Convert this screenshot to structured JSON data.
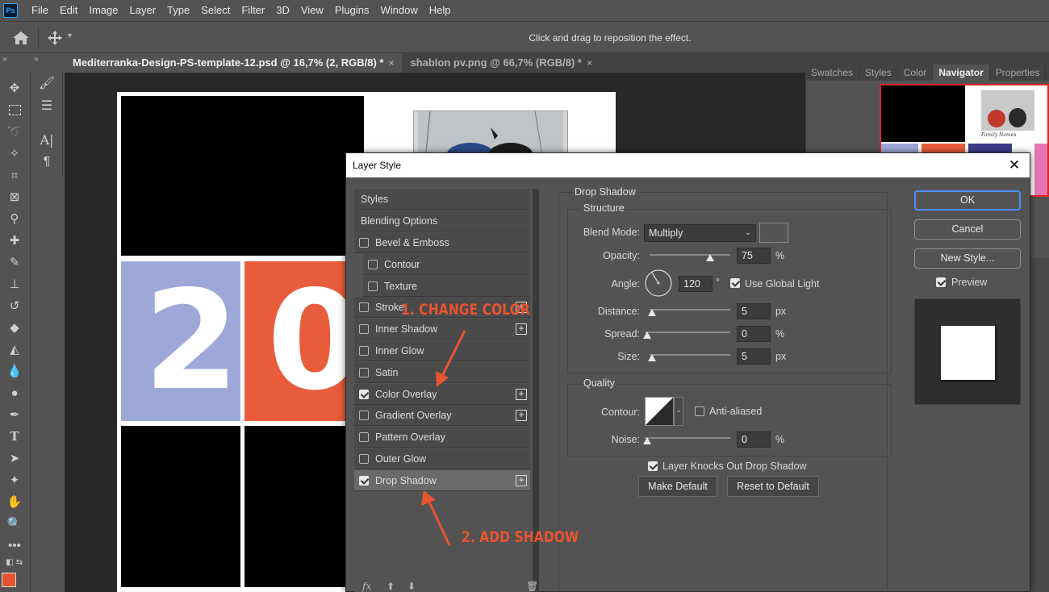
{
  "app": {
    "logo_text": "Ps"
  },
  "menu": [
    "File",
    "Edit",
    "Image",
    "Layer",
    "Type",
    "Select",
    "Filter",
    "3D",
    "View",
    "Plugins",
    "Window",
    "Help"
  ],
  "options_bar": {
    "hint": "Click and drag to reposition the effect."
  },
  "collapse_glyph": "»",
  "tabs": [
    {
      "label": "Mediterranka-Design-PS-template-12.psd @ 16,7% (2, RGB/8) *",
      "close": "×",
      "active": true
    },
    {
      "label": "shablon pv.png @ 66,7% (RGB/8) *",
      "close": "×",
      "active": false
    }
  ],
  "artboard": {
    "digits": [
      "2",
      "0"
    ],
    "colors": {
      "blue": "#9ea8d8",
      "orange": "#e85c3b",
      "black": "#000000"
    }
  },
  "panel_tabs": [
    "Swatches",
    "Styles",
    "Color",
    "Navigator",
    "Properties"
  ],
  "navigator": {
    "caption": "Family Names"
  },
  "dialog": {
    "title": "Layer Style",
    "close": "✕",
    "list_header": "Styles",
    "blending": "Blending Options",
    "items": [
      {
        "label": "Bevel & Emboss",
        "checked": false,
        "plus": false
      },
      {
        "label": "Contour",
        "checked": false,
        "plus": false,
        "indent": true
      },
      {
        "label": "Texture",
        "checked": false,
        "plus": false,
        "indent": true
      },
      {
        "label": "Stroke",
        "checked": false,
        "plus": true
      },
      {
        "label": "Inner Shadow",
        "checked": false,
        "plus": true
      },
      {
        "label": "Inner Glow",
        "checked": false,
        "plus": false
      },
      {
        "label": "Satin",
        "checked": false,
        "plus": false
      },
      {
        "label": "Color Overlay",
        "checked": true,
        "plus": true
      },
      {
        "label": "Gradient Overlay",
        "checked": false,
        "plus": true
      },
      {
        "label": "Pattern Overlay",
        "checked": false,
        "plus": false
      },
      {
        "label": "Outer Glow",
        "checked": false,
        "plus": false
      },
      {
        "label": "Drop Shadow",
        "checked": true,
        "plus": true,
        "selected": true
      }
    ],
    "footer_fx": "fx",
    "drop_shadow": {
      "section": "Drop Shadow",
      "structure": "Structure",
      "blend_mode_label": "Blend Mode:",
      "blend_mode": "Multiply",
      "shadow_color": "#555555",
      "opacity_label": "Opacity:",
      "opacity": "75",
      "opacity_level": 0.75,
      "angle_label": "Angle:",
      "angle": "120",
      "degree": "°",
      "global_light": "Use Global Light",
      "distance_label": "Distance:",
      "distance": "5",
      "spread_label": "Spread:",
      "spread": "0",
      "size_label": "Size:",
      "size": "5",
      "px": "px",
      "pct": "%",
      "quality": "Quality",
      "contour_label": "Contour:",
      "anti_aliased": "Anti-aliased",
      "noise_label": "Noise:",
      "noise": "0",
      "knocks_out": "Layer Knocks Out Drop Shadow",
      "make_default": "Make Default",
      "reset_default": "Reset to Default"
    },
    "buttons": {
      "ok": "OK",
      "cancel": "Cancel",
      "new_style": "New Style...",
      "preview": "Preview"
    }
  },
  "annotations": {
    "step1": "1. CHANGE COLOR",
    "step2": "2. ADD SHADOW",
    "color": "#e8542f"
  },
  "swatches": {
    "foreground": "#e8542f",
    "background": "#3a3a8a"
  }
}
